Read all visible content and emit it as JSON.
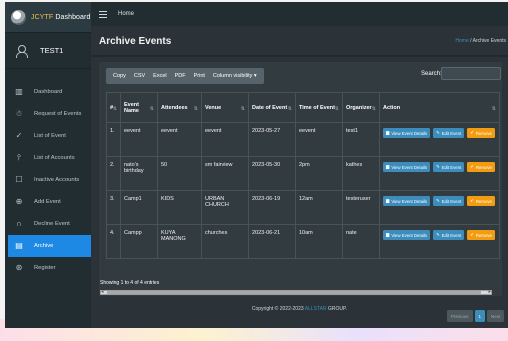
{
  "brand": {
    "logo_text_accent": "JCYTF",
    "logo_text_rest": " Dashboard"
  },
  "user": {
    "name": "TEST1"
  },
  "topbar": {
    "home": "Home"
  },
  "sidebar": {
    "items": [
      {
        "label": "Dashboard",
        "icon": "bar-chart-icon"
      },
      {
        "label": "Request of Events",
        "icon": "users-icon"
      },
      {
        "label": "List of Event",
        "icon": "check-icon"
      },
      {
        "label": "List of Accounts",
        "icon": "person-icon"
      },
      {
        "label": "Inactive Accounts",
        "icon": "comments-icon"
      },
      {
        "label": "Add Event",
        "icon": "plus-circle-icon"
      },
      {
        "label": "Decline Event",
        "icon": "headphones-icon"
      },
      {
        "label": "Archive",
        "icon": "archive-icon",
        "active": true
      },
      {
        "label": "Register",
        "icon": "globe-icon"
      }
    ]
  },
  "page": {
    "title": "Archive Events",
    "breadcrumb_home": "Home",
    "breadcrumb_sep": " / ",
    "breadcrumb_current": "Archive Events"
  },
  "toolbar": {
    "buttons": [
      "Copy",
      "CSV",
      "Excel",
      "PDF",
      "Print",
      "Column visibility ▾"
    ],
    "search_label": "Search:",
    "search_value": ""
  },
  "table": {
    "headers": [
      "#",
      "Event Name",
      "Attendees",
      "Venue",
      "Date of Event",
      "Time of Event",
      "Organizer",
      "Action"
    ],
    "rows": [
      {
        "num": "1.",
        "name": "eevent",
        "attendees": "eevent",
        "venue": "eevent",
        "date": "2023-05-27",
        "time": "eevent",
        "organizer": "test1"
      },
      {
        "num": "2.",
        "name": "nato's birthday",
        "attendees": "50",
        "venue": "sm fairview",
        "date": "2023-05-30",
        "time": "2pm",
        "organizer": "kathes"
      },
      {
        "num": "3.",
        "name": "Camp1",
        "attendees": "KIDS",
        "venue": "URBAN CHURCH",
        "date": "2023-06-19",
        "time": "12am",
        "organizer": "testeruser"
      },
      {
        "num": "4.",
        "name": "Campp",
        "attendees": "KUYA MANONG",
        "venue": "churches",
        "date": "2023-06-21",
        "time": "10am",
        "organizer": "nate"
      }
    ],
    "action_labels": {
      "view": "View Event Details",
      "edit": "Edit Event",
      "remove": "Remove"
    }
  },
  "table_info": "Showing 1 to 4 of 4 entries",
  "pager": {
    "previous": "Previous",
    "current": "1",
    "next": "Next"
  },
  "footer": {
    "prefix": "Copyright © 2022-2023 ",
    "brand": "ALLSTAR",
    "suffix": " GROUP."
  }
}
